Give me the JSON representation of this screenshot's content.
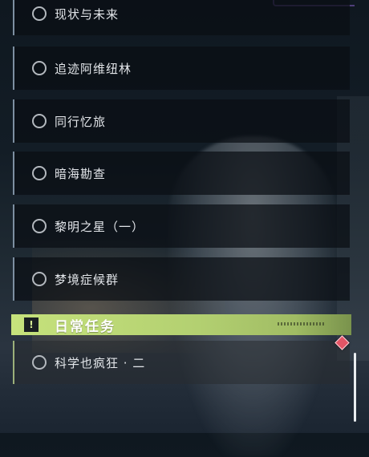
{
  "quests": [
    {
      "label": "现状与未来"
    },
    {
      "label": "追迹阿维纽林"
    },
    {
      "label": "同行忆旅"
    },
    {
      "label": "暗海勘查"
    },
    {
      "label": "黎明之星（一）"
    },
    {
      "label": "梦境症候群"
    }
  ],
  "daily_section": {
    "title": "日常任务",
    "icon": "alert-icon",
    "icon_glyph": "!",
    "accent_color": "#c6e27c"
  },
  "daily_quests": [
    {
      "label": "科学也疯狂 · 二"
    }
  ],
  "colors": {
    "marker": "#e35566",
    "quest_bar": "#7d8fa1"
  }
}
